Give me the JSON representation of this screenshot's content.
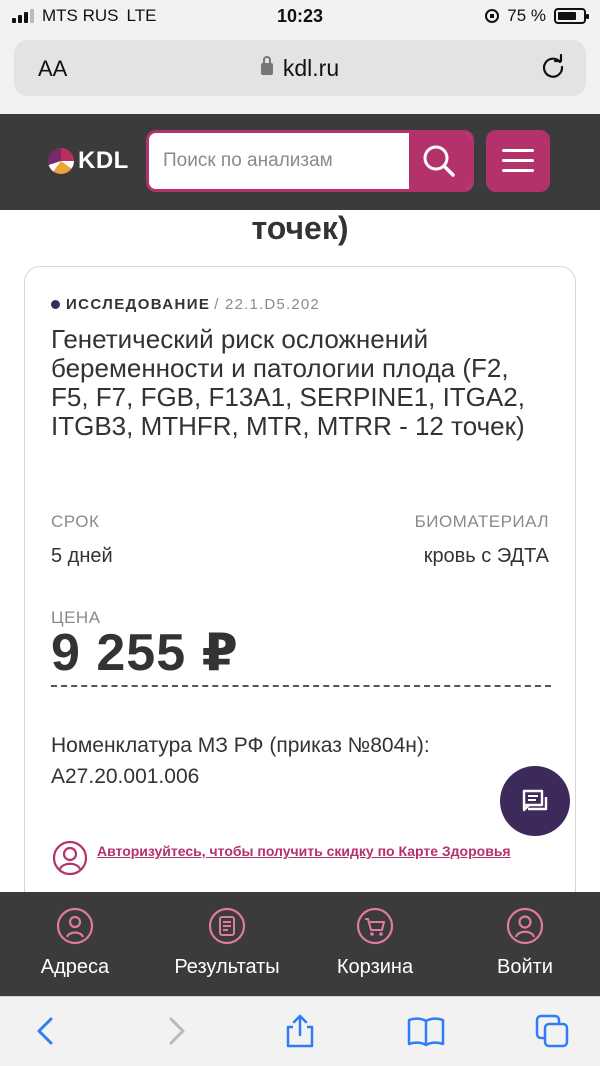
{
  "status_bar": {
    "carrier": "MTS RUS",
    "network": "LTE",
    "time": "10:23",
    "battery_percent": "75 %",
    "battery_level": 0.75
  },
  "browser": {
    "text_size_label": "AA",
    "url": "kdl.ru"
  },
  "header": {
    "logo_text": "KDL",
    "search_placeholder": "Поиск по анализам"
  },
  "content": {
    "partial_title": "точек)",
    "card": {
      "type_label": "ИССЛЕДОВАНИЕ",
      "code": "/ 22.1.D5.202",
      "title": "Генетический риск осложнений беременности и патологии плода (F2, F5, F7, FGB, F13A1, SERPINE1, ITGA2, ITGB3, MTHFR, MTR, MTRR - 12 точек)",
      "term_label": "СРОК",
      "term_value": "5 дней",
      "biomaterial_label": "БИОМАТЕРИАЛ",
      "biomaterial_value": "кровь с ЭДТА",
      "price_label": "ЦЕНА",
      "price_value": "9 255 ₽",
      "nomenclature": "Номенклатура МЗ РФ (приказ №804н): A27.20.001.006",
      "promo_link": "Авторизуйтесь, чтобы получить скидку по Карте Здоровья"
    }
  },
  "bottom_nav": [
    {
      "label": "Адреса",
      "icon": "location-pin-icon"
    },
    {
      "label": "Результаты",
      "icon": "results-document-icon"
    },
    {
      "label": "Корзина",
      "icon": "cart-icon"
    },
    {
      "label": "Войти",
      "icon": "user-icon"
    }
  ],
  "colors": {
    "brand": "#b3326b",
    "header_bg": "#3b3b3b",
    "accent_dark": "#3e2a5a"
  }
}
